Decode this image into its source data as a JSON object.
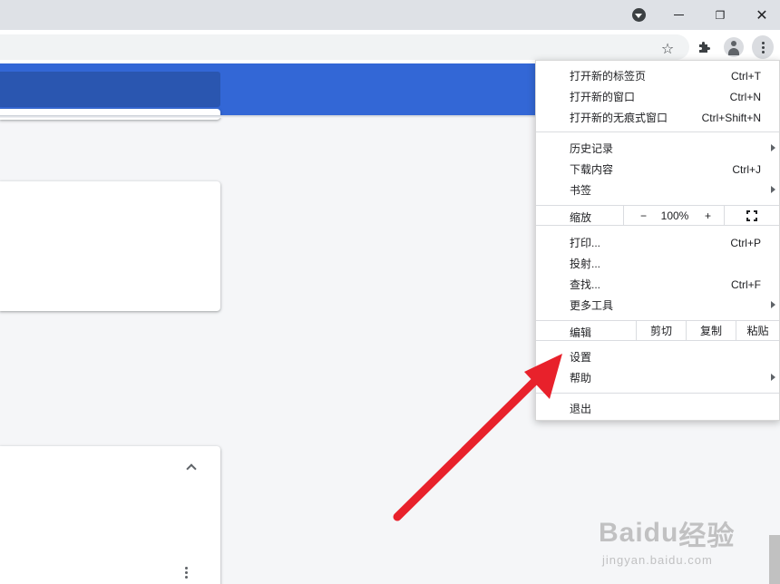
{
  "titlebar": {
    "minimize": "—",
    "restore": "❐",
    "close": "✕"
  },
  "toolbar": {
    "star_icon": "☆",
    "extensions_icon": "puzzle-icon",
    "profile_icon": "avatar",
    "menu_icon": "kebab"
  },
  "menu": {
    "new_tab": {
      "label": "打开新的标签页",
      "shortcut": "Ctrl+T"
    },
    "new_window": {
      "label": "打开新的窗口",
      "shortcut": "Ctrl+N"
    },
    "new_incognito": {
      "label": "打开新的无痕式窗口",
      "shortcut": "Ctrl+Shift+N"
    },
    "history": {
      "label": "历史记录"
    },
    "downloads": {
      "label": "下载内容",
      "shortcut": "Ctrl+J"
    },
    "bookmarks": {
      "label": "书签"
    },
    "zoom": {
      "label": "缩放",
      "minus": "−",
      "value": "100%",
      "plus": "+"
    },
    "print": {
      "label": "打印...",
      "shortcut": "Ctrl+P"
    },
    "cast": {
      "label": "投射..."
    },
    "find": {
      "label": "查找...",
      "shortcut": "Ctrl+F"
    },
    "more_tools": {
      "label": "更多工具"
    },
    "edit": {
      "label": "编辑",
      "cut": "剪切",
      "copy": "复制",
      "paste": "粘贴"
    },
    "settings": {
      "label": "设置"
    },
    "help": {
      "label": "帮助"
    },
    "exit": {
      "label": "退出"
    }
  },
  "watermark": {
    "brand": "Baidu",
    "brand_suffix": "经验",
    "url": "jingyan.baidu.com"
  },
  "colors": {
    "header": "#3367d6",
    "arrow": "#e8212b"
  }
}
